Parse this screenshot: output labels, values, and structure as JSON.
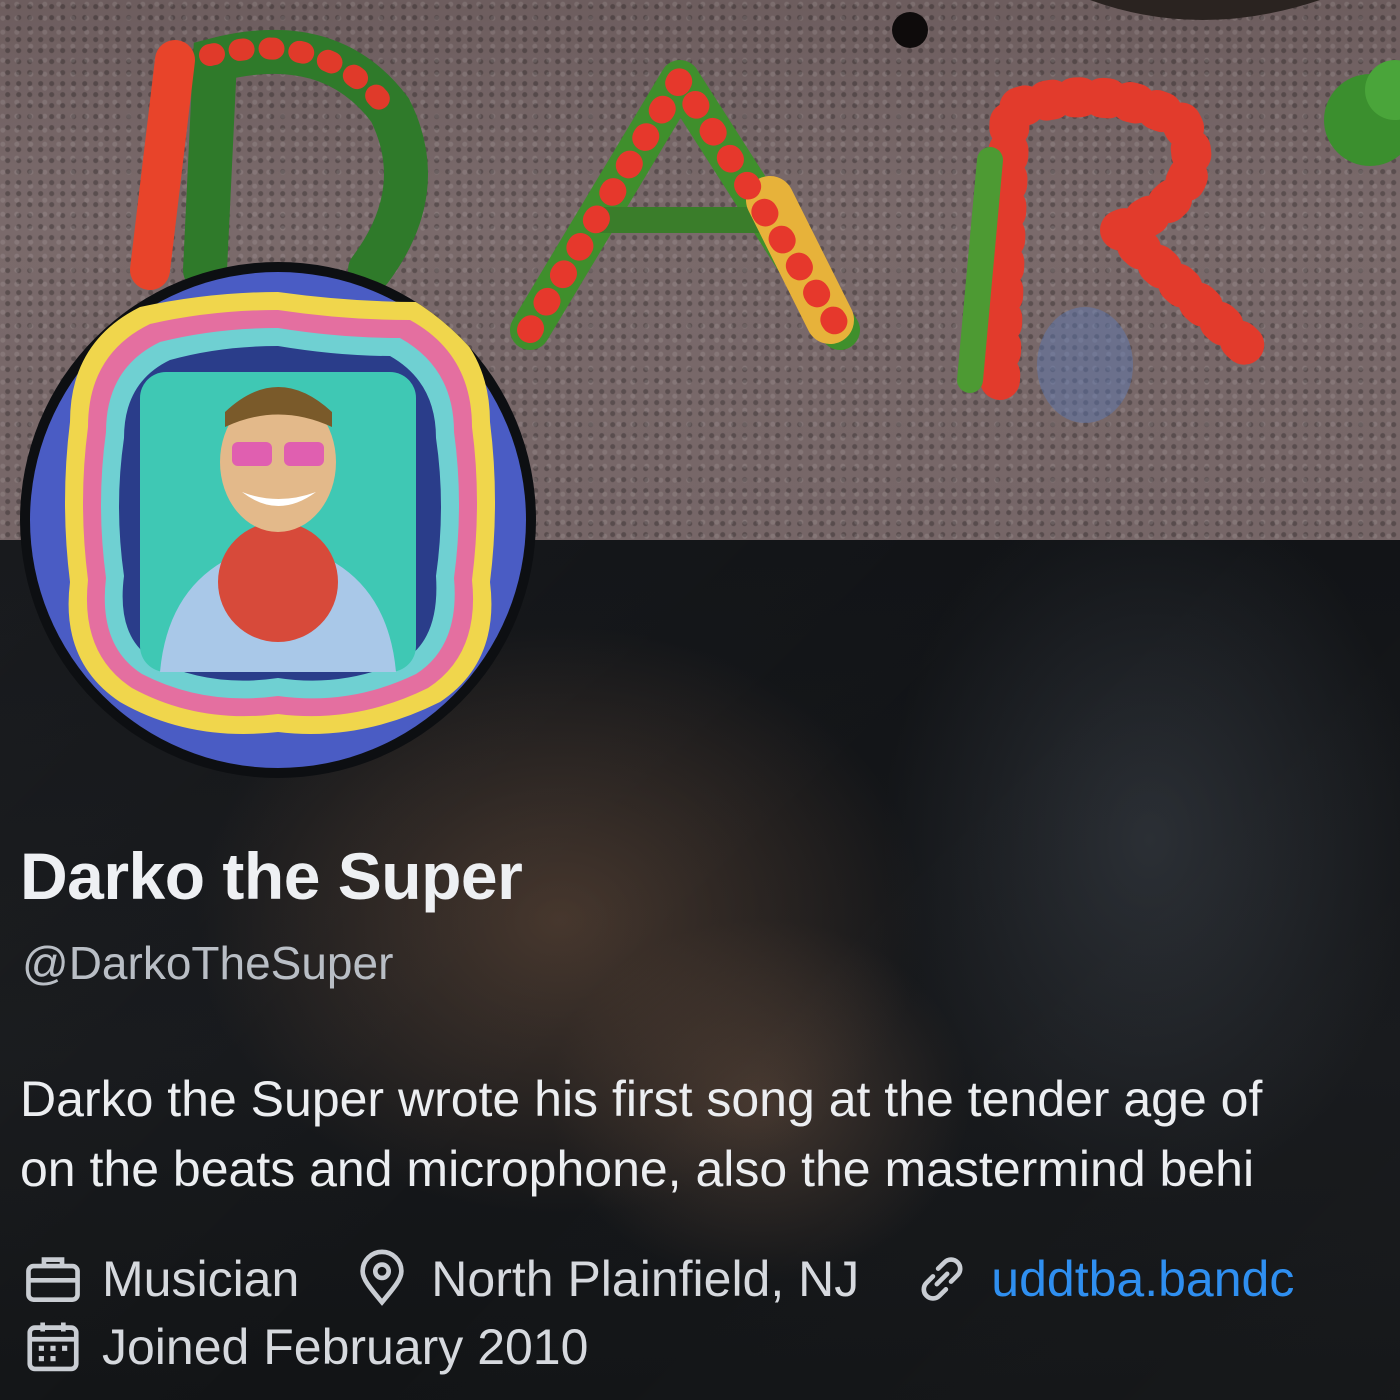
{
  "profile": {
    "display_name": "Darko the Super",
    "handle": "@DarkoTheSuper",
    "bio_lines": [
      "Darko the Super wrote his first song at the tender age of",
      "on the beats and microphone, also the mastermind behi"
    ],
    "category": "Musician",
    "location": "North Plainfield, NJ",
    "website": "uddtba.bandc",
    "joined": "Joined February 2010"
  },
  "icons": {
    "category": "briefcase-icon",
    "location": "map-pin-icon",
    "website": "link-icon",
    "joined": "calendar-icon"
  },
  "colors": {
    "link": "#2f8ff0",
    "text_primary": "#eef0f3",
    "text_secondary": "#b9bec5",
    "avatar_bg": "#4a5cc4"
  }
}
